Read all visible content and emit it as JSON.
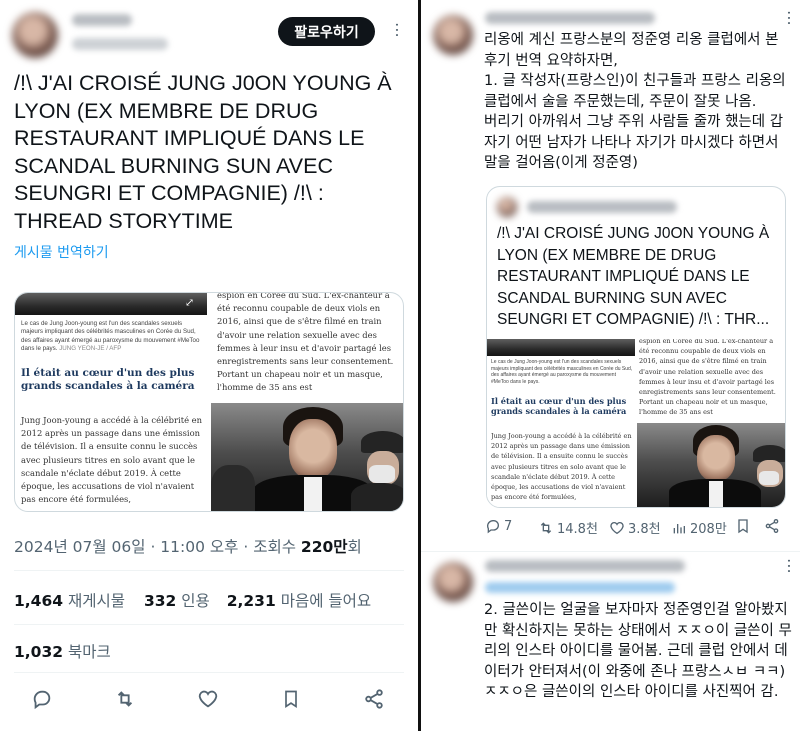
{
  "left_tweet": {
    "follow_label": "팔로우하기",
    "text": "/!\\ J'AI CROISÉ JUNG J0ON YOUNG À LYON (EX MEMBRE DE DRUG RESTAURANT IMPLIQUÉ DANS LE SCANDAL BURNING SUN AVEC SEUNGRI ET COMPAGNIE) /!\\ : THREAD STORYTIME",
    "translate_label": "게시물 번역하기",
    "timestamp": "2024년 07월 06일 · 11:00 오후 · 조회수 ",
    "views": "220만",
    "views_suffix": "회",
    "stats": {
      "reposts_count": "1,464",
      "reposts_label": "재게시물",
      "quotes_count": "332",
      "quotes_label": "인용",
      "likes_count": "2,231",
      "likes_label": "마음에 들어요",
      "bookmarks_count": "1,032",
      "bookmarks_label": "북마크"
    }
  },
  "article": {
    "top_right": "espion en Corée du Sud. L'ex-chanteur a été reconnu coupable de deux viols en 2016, ainsi que de s'être filmé en train d'avoir une relation sexuelle avec des femmes à leur insu et d'avoir partagé les enregistrements sans leur consentement. Portant un chapeau noir et un masque, l'homme de 35 ans est",
    "caption": "Le cas de Jung Joon-young est l'un des scandales sexuels majeurs impliquant des célébrités masculines en Corée du Sud, des affaires ayant émergé au paroxysme du mouvement #MeToo dans le pays.",
    "credit": "JUNG YEON-JE / AFP",
    "heading": "Il était au cœur d'un des plus grands scandales à la caméra",
    "bottom_left": "Jung Joon-young a accédé à la célébrité en 2012 après un passage dans une émission de télévision. Il a ensuite connu le succès avec plusieurs titres en solo avant que le scandale n'éclate début 2019. À cette époque, les accusations de viol n'avaient pas encore été formulées,"
  },
  "right_reply1": {
    "text": "리옹에 계신 프랑스분의 정준영 리옹 클럽에서 본 후기 번역 요약하자면,\n1. 글 작성자(프랑스인)이 친구들과 프랑스 리옹의 클럽에서 술을 주문했는데, 주문이 잘못 나옴.\n버리기 아까워서 그냥 주위 사람들 줄까 했는데 갑자기 어떤 남자가 나타나 자기가 마시겠다 하면서 말을 걸어옴(이게 정준영)",
    "quote_text": "/!\\ J'AI CROISÉ JUNG J0ON YOUNG À LYON (EX MEMBRE DE DRUG RESTAURANT IMPLIQUÉ DANS LE SCANDAL BURNING SUN AVEC SEUNGRI ET COMPAGNIE) /!\\ : THR...",
    "replies": "7",
    "reposts": "14.8천",
    "likes": "3.8천",
    "views": "208만"
  },
  "right_reply2": {
    "text": "2. 글쓴이는 얼굴을 보자마자 정준영인걸 알아봤지만 확신하지는 못하는 상태에서 ㅈㅈㅇ이 글쓴이 무리의 인스타 아이디를 물어봄. 근데 클럽 안에서 데이터가 안터져서(이 와중에 존나 프랑스ㅅㅂ ㅋㅋ)ㅈㅈㅇ은 글쓴이의 인스타 아이디를 사진찍어 감."
  }
}
